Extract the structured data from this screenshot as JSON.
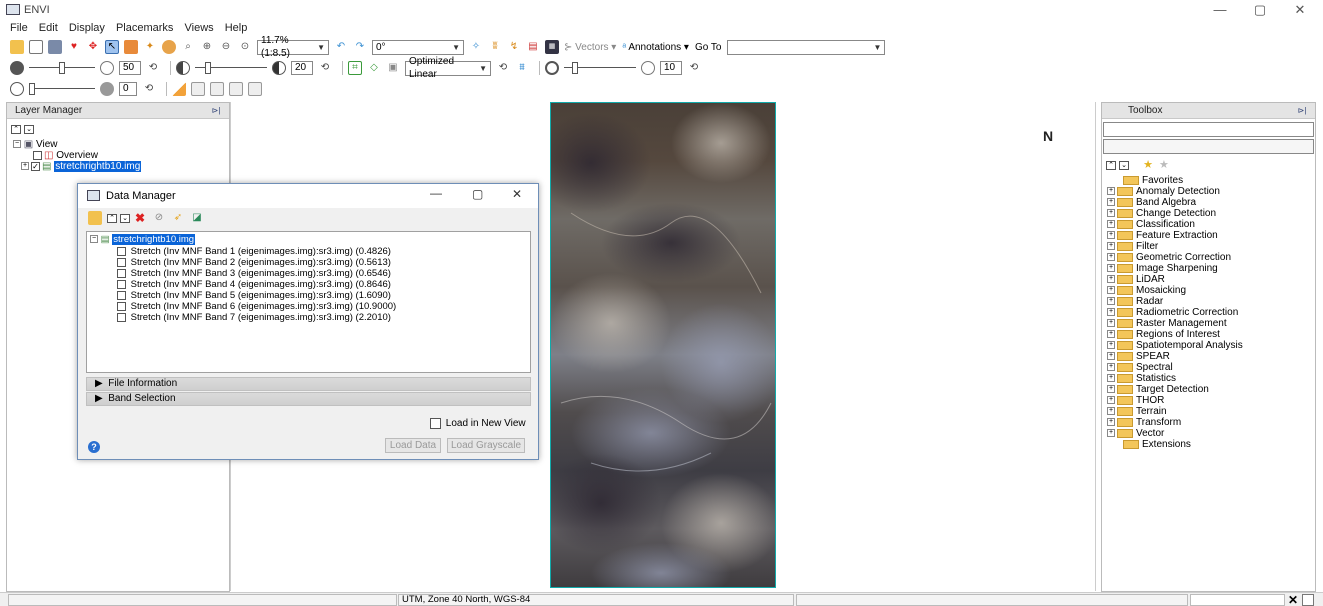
{
  "window": {
    "title": "ENVI",
    "minimize": "—",
    "restore": "▢",
    "close": "✕"
  },
  "menu": [
    "File",
    "Edit",
    "Display",
    "Placemarks",
    "Views",
    "Help"
  ],
  "toolbar1": {
    "zoom_value": "11.7% (1:8.5)",
    "rotation_value": "0°",
    "vectors_label": "Vectors",
    "annotations_label": "Annotations",
    "goto_label": "Go To",
    "goto_value": ""
  },
  "toolbar2": {
    "brightness": "50",
    "contrast": "20",
    "stretch_value": "Optimized Linear",
    "sharpen": "10"
  },
  "toolbar3": {
    "transparency": "0"
  },
  "layer_manager": {
    "title": "Layer Manager",
    "view_label": "View",
    "overview_label": "Overview",
    "layer_label": "stretchrightb10.img"
  },
  "data_manager": {
    "title": "Data Manager",
    "file_name": "stretchrightb10.img",
    "bands": [
      "Stretch (Inv MNF Band 1 (eigenimages.img):sr3.img) (0.4826)",
      "Stretch (Inv MNF Band 2 (eigenimages.img):sr3.img) (0.5613)",
      "Stretch (Inv MNF Band 3 (eigenimages.img):sr3.img) (0.6546)",
      "Stretch (Inv MNF Band 4 (eigenimages.img):sr3.img) (0.8646)",
      "Stretch (Inv MNF Band 5 (eigenimages.img):sr3.img) (1.6090)",
      "Stretch (Inv MNF Band 6 (eigenimages.img):sr3.img) (10.9000)",
      "Stretch (Inv MNF Band 7 (eigenimages.img):sr3.img) (2.2010)"
    ],
    "file_information_label": "File Information",
    "band_selection_label": "Band Selection",
    "load_new_view_label": "Load in New View",
    "load_data_label": "Load Data",
    "load_grayscale_label": "Load Grayscale",
    "help_icon": "?"
  },
  "view": {
    "north_label": "N"
  },
  "toolbox": {
    "title": "Toolbox",
    "items": [
      "Favorites",
      "Anomaly Detection",
      "Band Algebra",
      "Change Detection",
      "Classification",
      "Feature Extraction",
      "Filter",
      "Geometric Correction",
      "Image Sharpening",
      "LiDAR",
      "Mosaicking",
      "Radar",
      "Radiometric Correction",
      "Raster Management",
      "Regions of Interest",
      "Spatiotemporal Analysis",
      "SPEAR",
      "Spectral",
      "Statistics",
      "Target Detection",
      "THOR",
      "Terrain",
      "Transform",
      "Vector",
      "Extensions"
    ]
  },
  "status": {
    "projection": "UTM, Zone 40 North, WGS-84"
  },
  "colors": {
    "selection": "#0a64d8",
    "image_border": "#11aaaa",
    "folder": "#f3c65a"
  }
}
